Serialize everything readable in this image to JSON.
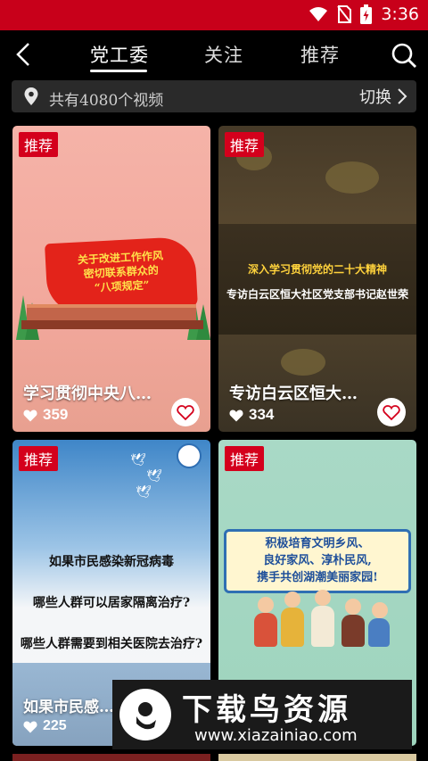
{
  "status": {
    "time": "3:36",
    "icons": [
      "wifi-icon",
      "no-sim-icon",
      "battery-icon"
    ]
  },
  "header": {
    "tabs": [
      "党工委",
      "关注",
      "推荐"
    ],
    "active_tab": "党工委"
  },
  "location_bar": {
    "text": "共有4080个视频",
    "switch_label": "切换"
  },
  "cards": [
    {
      "badge": "推荐",
      "title": "学习贯彻中央八…",
      "likes": "359",
      "banner_lines": [
        "关于改进工作作风",
        "密切联系群众的",
        "“八项规定”"
      ]
    },
    {
      "badge": "推荐",
      "title": "专访白云区恒大…",
      "likes": "334",
      "overlay_line1": "深入学习贯彻党的二十大精神",
      "overlay_line2": "专访白云区恒大社区党支部书记赵世荣"
    },
    {
      "badge": "推荐",
      "title": "如果市民感…",
      "likes": "225",
      "lines": [
        "如果市民感染新冠病毒",
        "哪些人群可以居家隔离治疗?",
        "哪些人群需要到相关医院去治疗?"
      ]
    },
    {
      "badge": "推荐",
      "scroll_lines": [
        "积极培育文明乡风、",
        "良好家风、淳朴民风,",
        "携手共创湖潮美丽家园!"
      ]
    }
  ],
  "watermark": {
    "title": "下载鸟资源",
    "url": "www.xiazainiao.com"
  },
  "colors": {
    "status_bar": "#c8001a",
    "badge": "#d4001c",
    "background": "#000000"
  }
}
